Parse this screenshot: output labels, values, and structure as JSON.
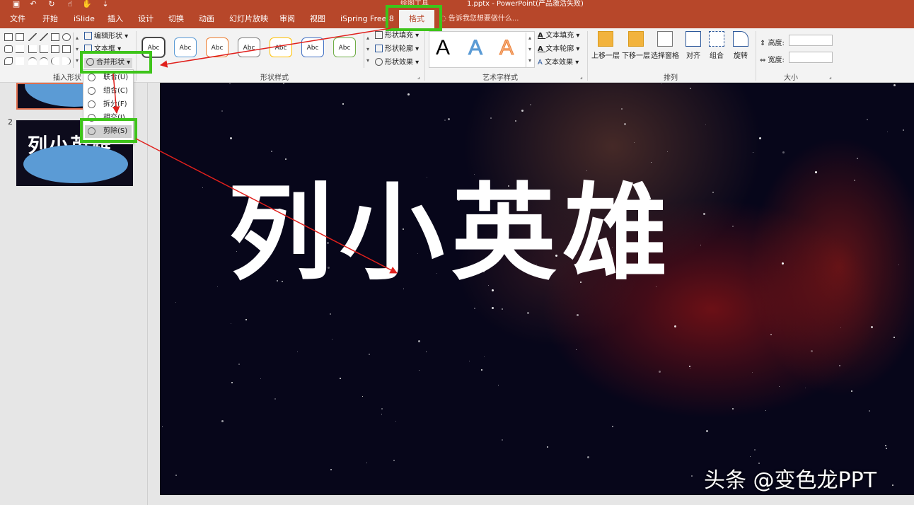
{
  "window": {
    "title": "1.pptx - PowerPoint(产品激活失败)",
    "context_group": "绘图工具",
    "qa_icons": [
      "save-icon",
      "undo-icon",
      "redo-icon",
      "touch-icon",
      "customize-icon"
    ]
  },
  "tabs": [
    {
      "label": "文件"
    },
    {
      "label": "开始"
    },
    {
      "label": "iSlide"
    },
    {
      "label": "插入"
    },
    {
      "label": "设计"
    },
    {
      "label": "切换"
    },
    {
      "label": "动画"
    },
    {
      "label": "幻灯片放映"
    },
    {
      "label": "审阅"
    },
    {
      "label": "视图"
    },
    {
      "label": "iSpring Free 8"
    }
  ],
  "active_tab": "格式",
  "tell_me": "告诉我您想要做什么...",
  "ribbon": {
    "insert_shapes": {
      "label": "插入形状",
      "edit_shape": "编辑形状",
      "text_box": "文本框",
      "merge_shapes": "合并形状"
    },
    "shape_styles": {
      "label": "形状样式",
      "sample": "Abc",
      "swatch_colors": [
        "#333333",
        "#5b9bd5",
        "#ed7d31",
        "#7f7f7f",
        "#ffc000",
        "#4472c4",
        "#70ad47"
      ],
      "fill": "形状填充",
      "outline": "形状轮廓",
      "effects": "形状效果"
    },
    "wordart": {
      "label": "艺术字样式",
      "letter": "A",
      "colors": [
        "#000000",
        "#5b9bd5",
        "#ed7d31"
      ],
      "text_fill": "文本填充",
      "text_outline": "文本轮廓",
      "text_effects": "文本效果"
    },
    "arrange": {
      "label": "排列",
      "bring_forward": "上移一层",
      "send_backward": "下移一层",
      "selection_pane": "选择窗格",
      "align": "对齐",
      "group": "组合",
      "rotate": "旋转"
    },
    "size": {
      "label": "大小",
      "height_label": "高度:",
      "width_label": "宽度:"
    }
  },
  "merge_menu": {
    "items": [
      {
        "label": "联合(U)"
      },
      {
        "label": "组合(C)"
      },
      {
        "label": "拆分(F)"
      },
      {
        "label": "相交(I)"
      },
      {
        "label": "剪除(S)"
      }
    ],
    "highlighted": "剪除(S)"
  },
  "thumbnails": {
    "slide_number": "2",
    "slide2_text": "列小英雄"
  },
  "slide": {
    "title": "列小英雄",
    "watermark": "头条 @变色龙PPT"
  },
  "annotation_color": "#3ec41a",
  "arrow_color": "#e0201c"
}
